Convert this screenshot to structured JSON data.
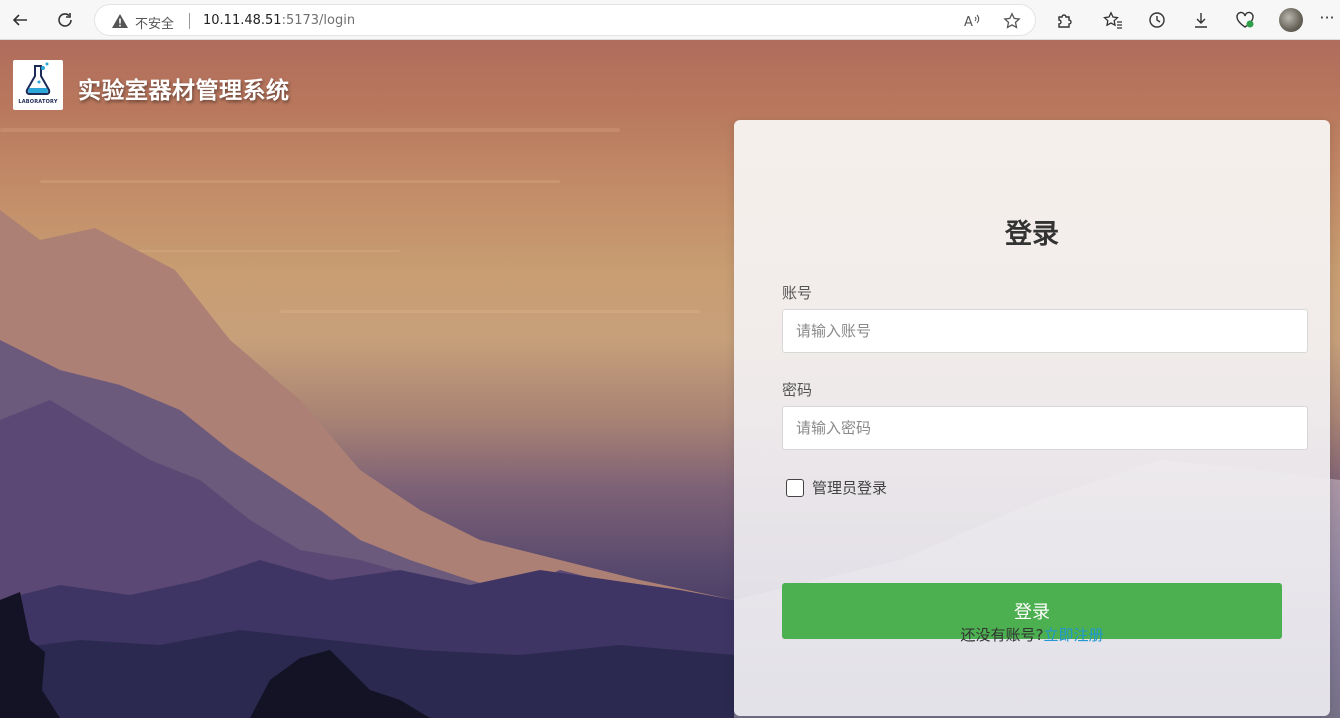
{
  "browser": {
    "insecure_label": "不安全",
    "url_host": "10.11.48.51",
    "url_rest": ":5173/login"
  },
  "site": {
    "title": "实验室器材管理系统",
    "logo_text": "LABORATORY"
  },
  "login": {
    "title": "登录",
    "account_label": "账号",
    "account_placeholder": "请输入账号",
    "password_label": "密码",
    "password_placeholder": "请输入密码",
    "admin_checkbox_label": "管理员登录",
    "admin_checked": false,
    "submit_label": "登录",
    "no_account_text": "还没有账号?",
    "register_link": "立即注册"
  },
  "colors": {
    "primary_button": "#4caf50",
    "link": "#2196d3",
    "sky_top": "#b06c5c",
    "sky_mid": "#c89d72",
    "mountains": "#59496e"
  }
}
